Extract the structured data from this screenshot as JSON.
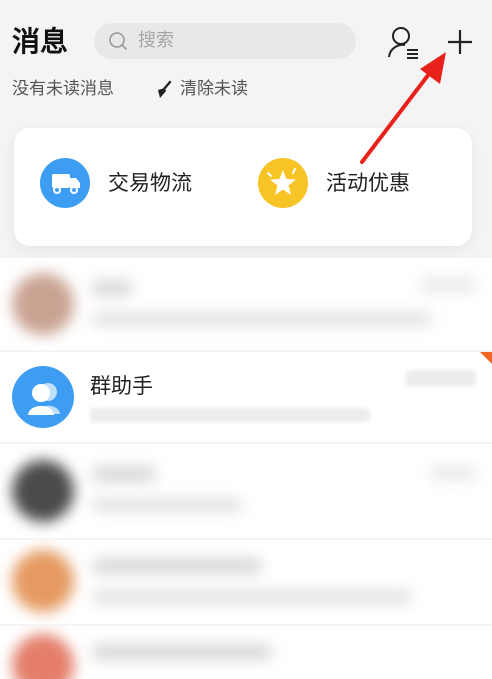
{
  "header": {
    "title": "消息",
    "search_placeholder": "搜索",
    "icons": [
      "search-icon",
      "contacts-icon",
      "add-icon"
    ]
  },
  "subbar": {
    "unread_status": "没有未读消息",
    "clear_unread": "清除未读"
  },
  "shortcuts": [
    {
      "label": "交易物流",
      "icon": "truck-icon",
      "color": "#3d9df2"
    },
    {
      "label": "活动优惠",
      "icon": "star-icon",
      "color": "#f7c325"
    }
  ],
  "conversations": [
    {
      "name": "群助手",
      "icon": "group-user-icon",
      "color": "#3d9df2"
    }
  ],
  "colors": {
    "accent_red": "#e8221a",
    "badge_orange": "#f26522"
  }
}
